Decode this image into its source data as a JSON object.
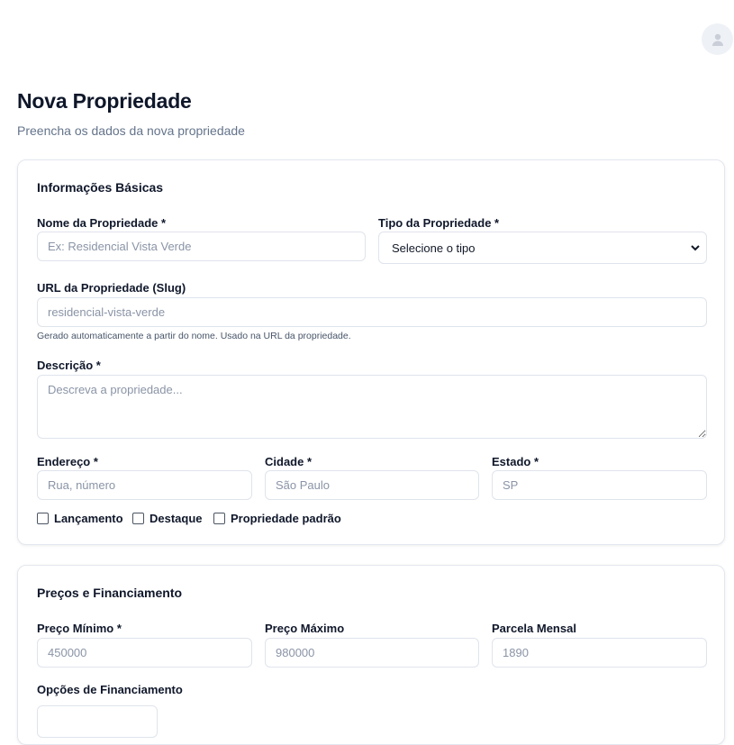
{
  "header": {
    "avatar_icon": "user-icon"
  },
  "page": {
    "title": "Nova Propriedade",
    "subtitle": "Preencha os dados da nova propriedade"
  },
  "basic_info": {
    "section_title": "Informações Básicas",
    "name": {
      "label": "Nome da Propriedade *",
      "placeholder": "Ex: Residencial Vista Verde"
    },
    "type": {
      "label": "Tipo da Propriedade *",
      "value": "Selecione o tipo"
    },
    "slug": {
      "label": "URL da Propriedade (Slug)",
      "placeholder": "residencial-vista-verde",
      "hint": "Gerado automaticamente a partir do nome. Usado na URL da propriedade."
    },
    "description": {
      "label": "Descrição *",
      "placeholder": "Descreva a propriedade..."
    },
    "address": {
      "label": "Endereço *",
      "placeholder": "Rua, número"
    },
    "city": {
      "label": "Cidade *",
      "placeholder": "São Paulo"
    },
    "state": {
      "label": "Estado *",
      "placeholder": "SP"
    },
    "checkboxes": [
      {
        "label": "Lançamento"
      },
      {
        "label": "Destaque"
      },
      {
        "label": "Propriedade padrão"
      }
    ]
  },
  "pricing": {
    "section_title": "Preços e Financiamento",
    "min_price": {
      "label": "Preço Mínimo *",
      "placeholder": "450000"
    },
    "max_price": {
      "label": "Preço Máximo",
      "placeholder": "980000"
    },
    "monthly": {
      "label": "Parcela Mensal",
      "placeholder": "1890"
    },
    "financing_label": "Opções de Financiamento"
  }
}
